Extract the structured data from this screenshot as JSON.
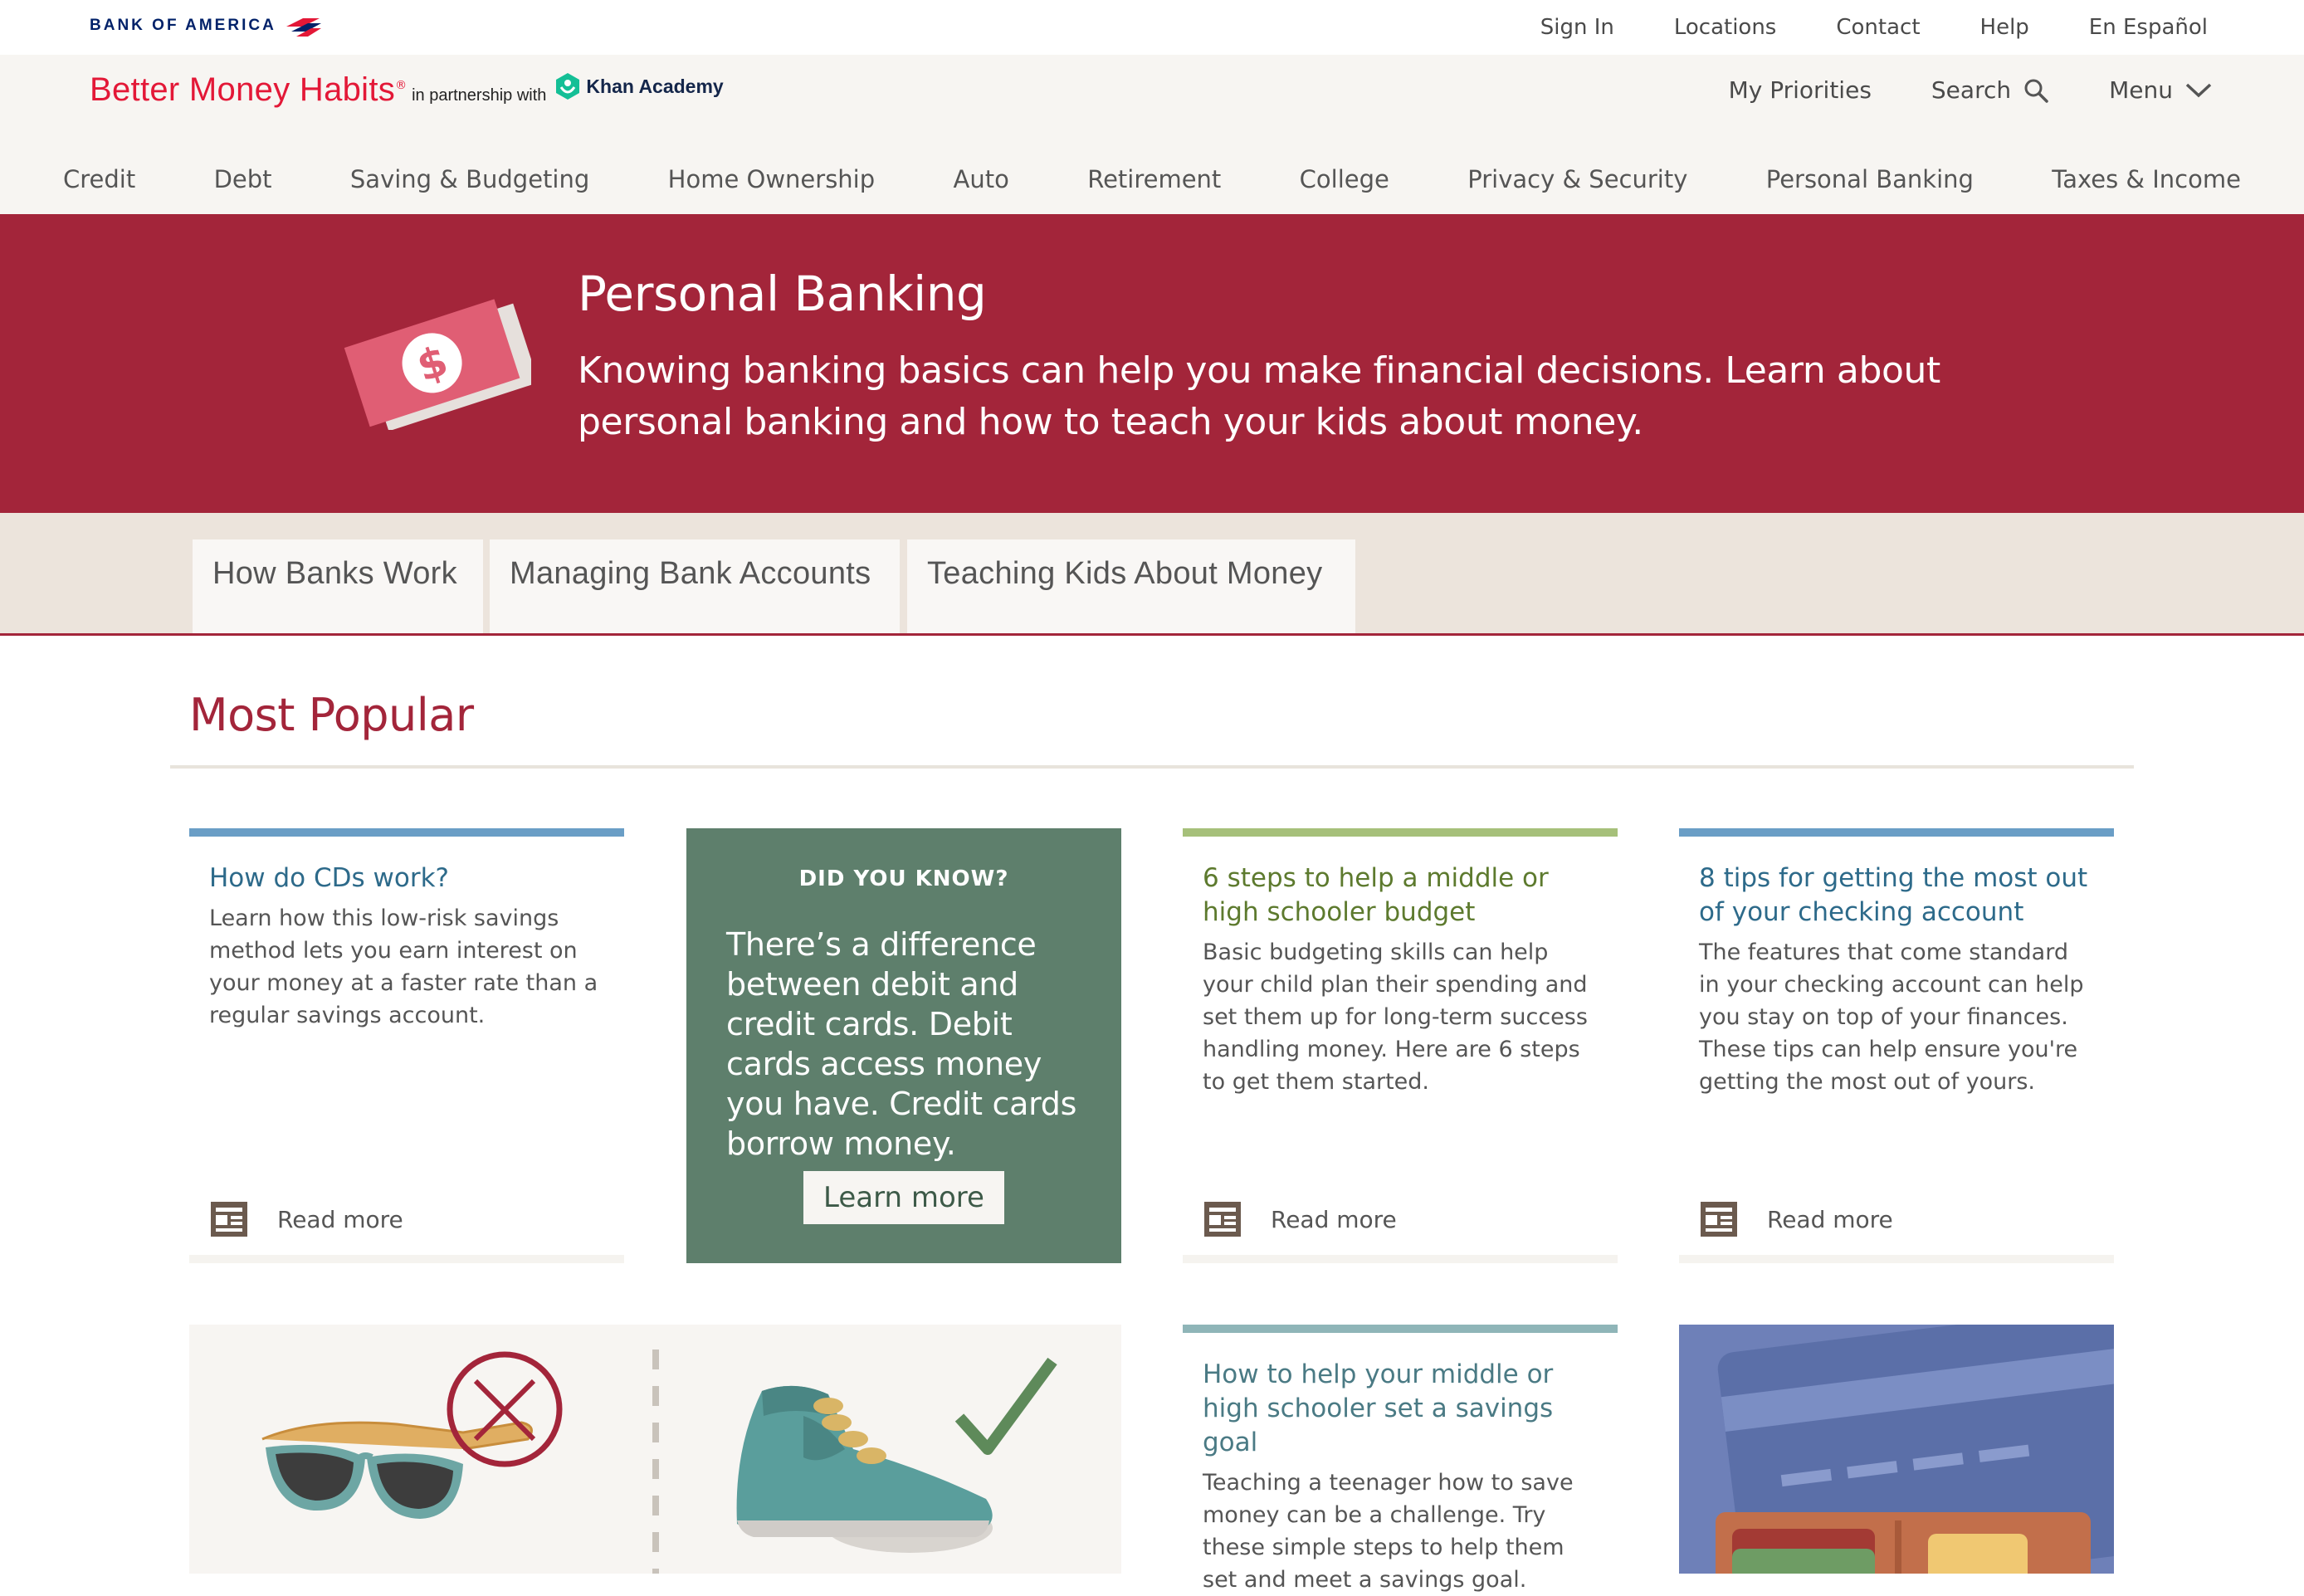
{
  "top": {
    "logo_text": "BANK OF AMERICA",
    "links": [
      "Sign In",
      "Locations",
      "Contact",
      "Help",
      "En Español"
    ]
  },
  "brand": {
    "name": "Better Money Habits",
    "reg": "®",
    "partner_text": "in partnership with",
    "partner_name": "Khan Academy",
    "right_nav": {
      "priorities": "My Priorities",
      "search": "Search",
      "menu": "Menu"
    }
  },
  "categories": [
    "Credit",
    "Debt",
    "Saving & Budgeting",
    "Home Ownership",
    "Auto",
    "Retirement",
    "College",
    "Privacy & Security",
    "Personal Banking",
    "Taxes & Income"
  ],
  "hero": {
    "title": "Personal Banking",
    "description": "Knowing banking basics can help you make financial decisions. Learn about personal banking and how to teach your kids about money."
  },
  "tabs": [
    "How Banks Work",
    "Managing Bank Accounts",
    "Teaching Kids About Money"
  ],
  "section_title": "Most Popular",
  "cards": [
    {
      "title": "How do CDs work?",
      "description": "Learn how this low-risk savings method lets you earn interest on your money at a faster rate than a regular savings account.",
      "link": "Read more",
      "accent": "#6a9ec6"
    },
    {
      "title": "6 steps to help a middle or high schooler budget",
      "description": "Basic budgeting skills can help your child plan their spending and set them up for long-term success handling money. Here are 6 steps to get them started.",
      "link": "Read more",
      "accent": "#a6c07a"
    },
    {
      "title": "8 tips for getting the most out of your checking account",
      "description": "The features that come standard in your checking account can help you stay on top of your finances. These tips can help ensure you're getting the most out of yours.",
      "link": "Read more",
      "accent": "#6a9ec6"
    },
    {
      "title": "How to help your middle or high schooler set a savings goal",
      "description": "Teaching a teenager how to save money can be a challenge. Try these simple steps to help them set and meet a savings goal.",
      "accent": "#8fb5b8"
    }
  ],
  "did_you_know": {
    "label": "DID YOU KNOW?",
    "body": "There’s a difference between debit and credit cards. Debit cards access money you have. Credit cards borrow money.",
    "button": "Learn more"
  },
  "colors": {
    "brand_red": "#a3253a",
    "boa_red": "#e31837",
    "boa_navy": "#012169",
    "dyk_green": "#5e7f6c"
  }
}
